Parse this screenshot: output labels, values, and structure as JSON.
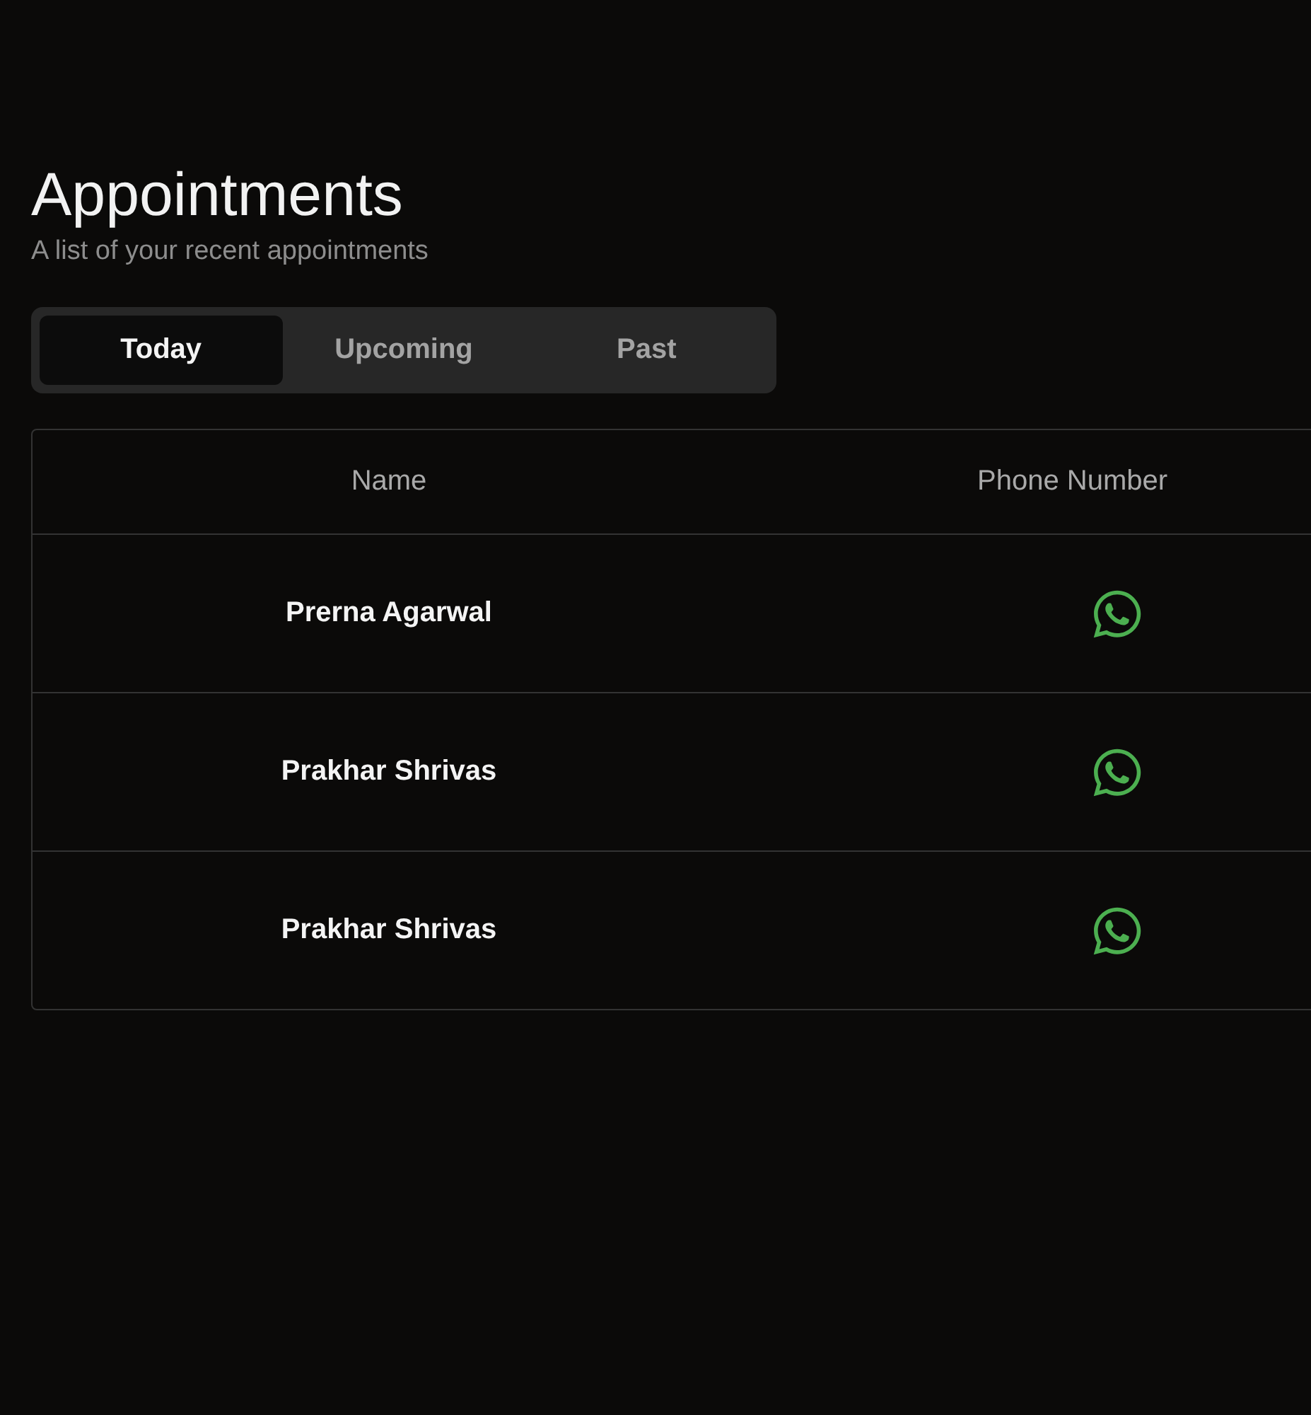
{
  "header": {
    "title": "Appointments",
    "subtitle": "A list of your recent appointments"
  },
  "tabs": [
    {
      "label": "Today",
      "selected": true
    },
    {
      "label": "Upcoming",
      "selected": false
    },
    {
      "label": "Past",
      "selected": false
    }
  ],
  "table": {
    "columns": [
      "Name",
      "Phone Number"
    ],
    "rows": [
      {
        "name": "Prerna Agarwal"
      },
      {
        "name": "Prakhar Shrivas"
      },
      {
        "name": "Prakhar Shrivas"
      }
    ]
  }
}
